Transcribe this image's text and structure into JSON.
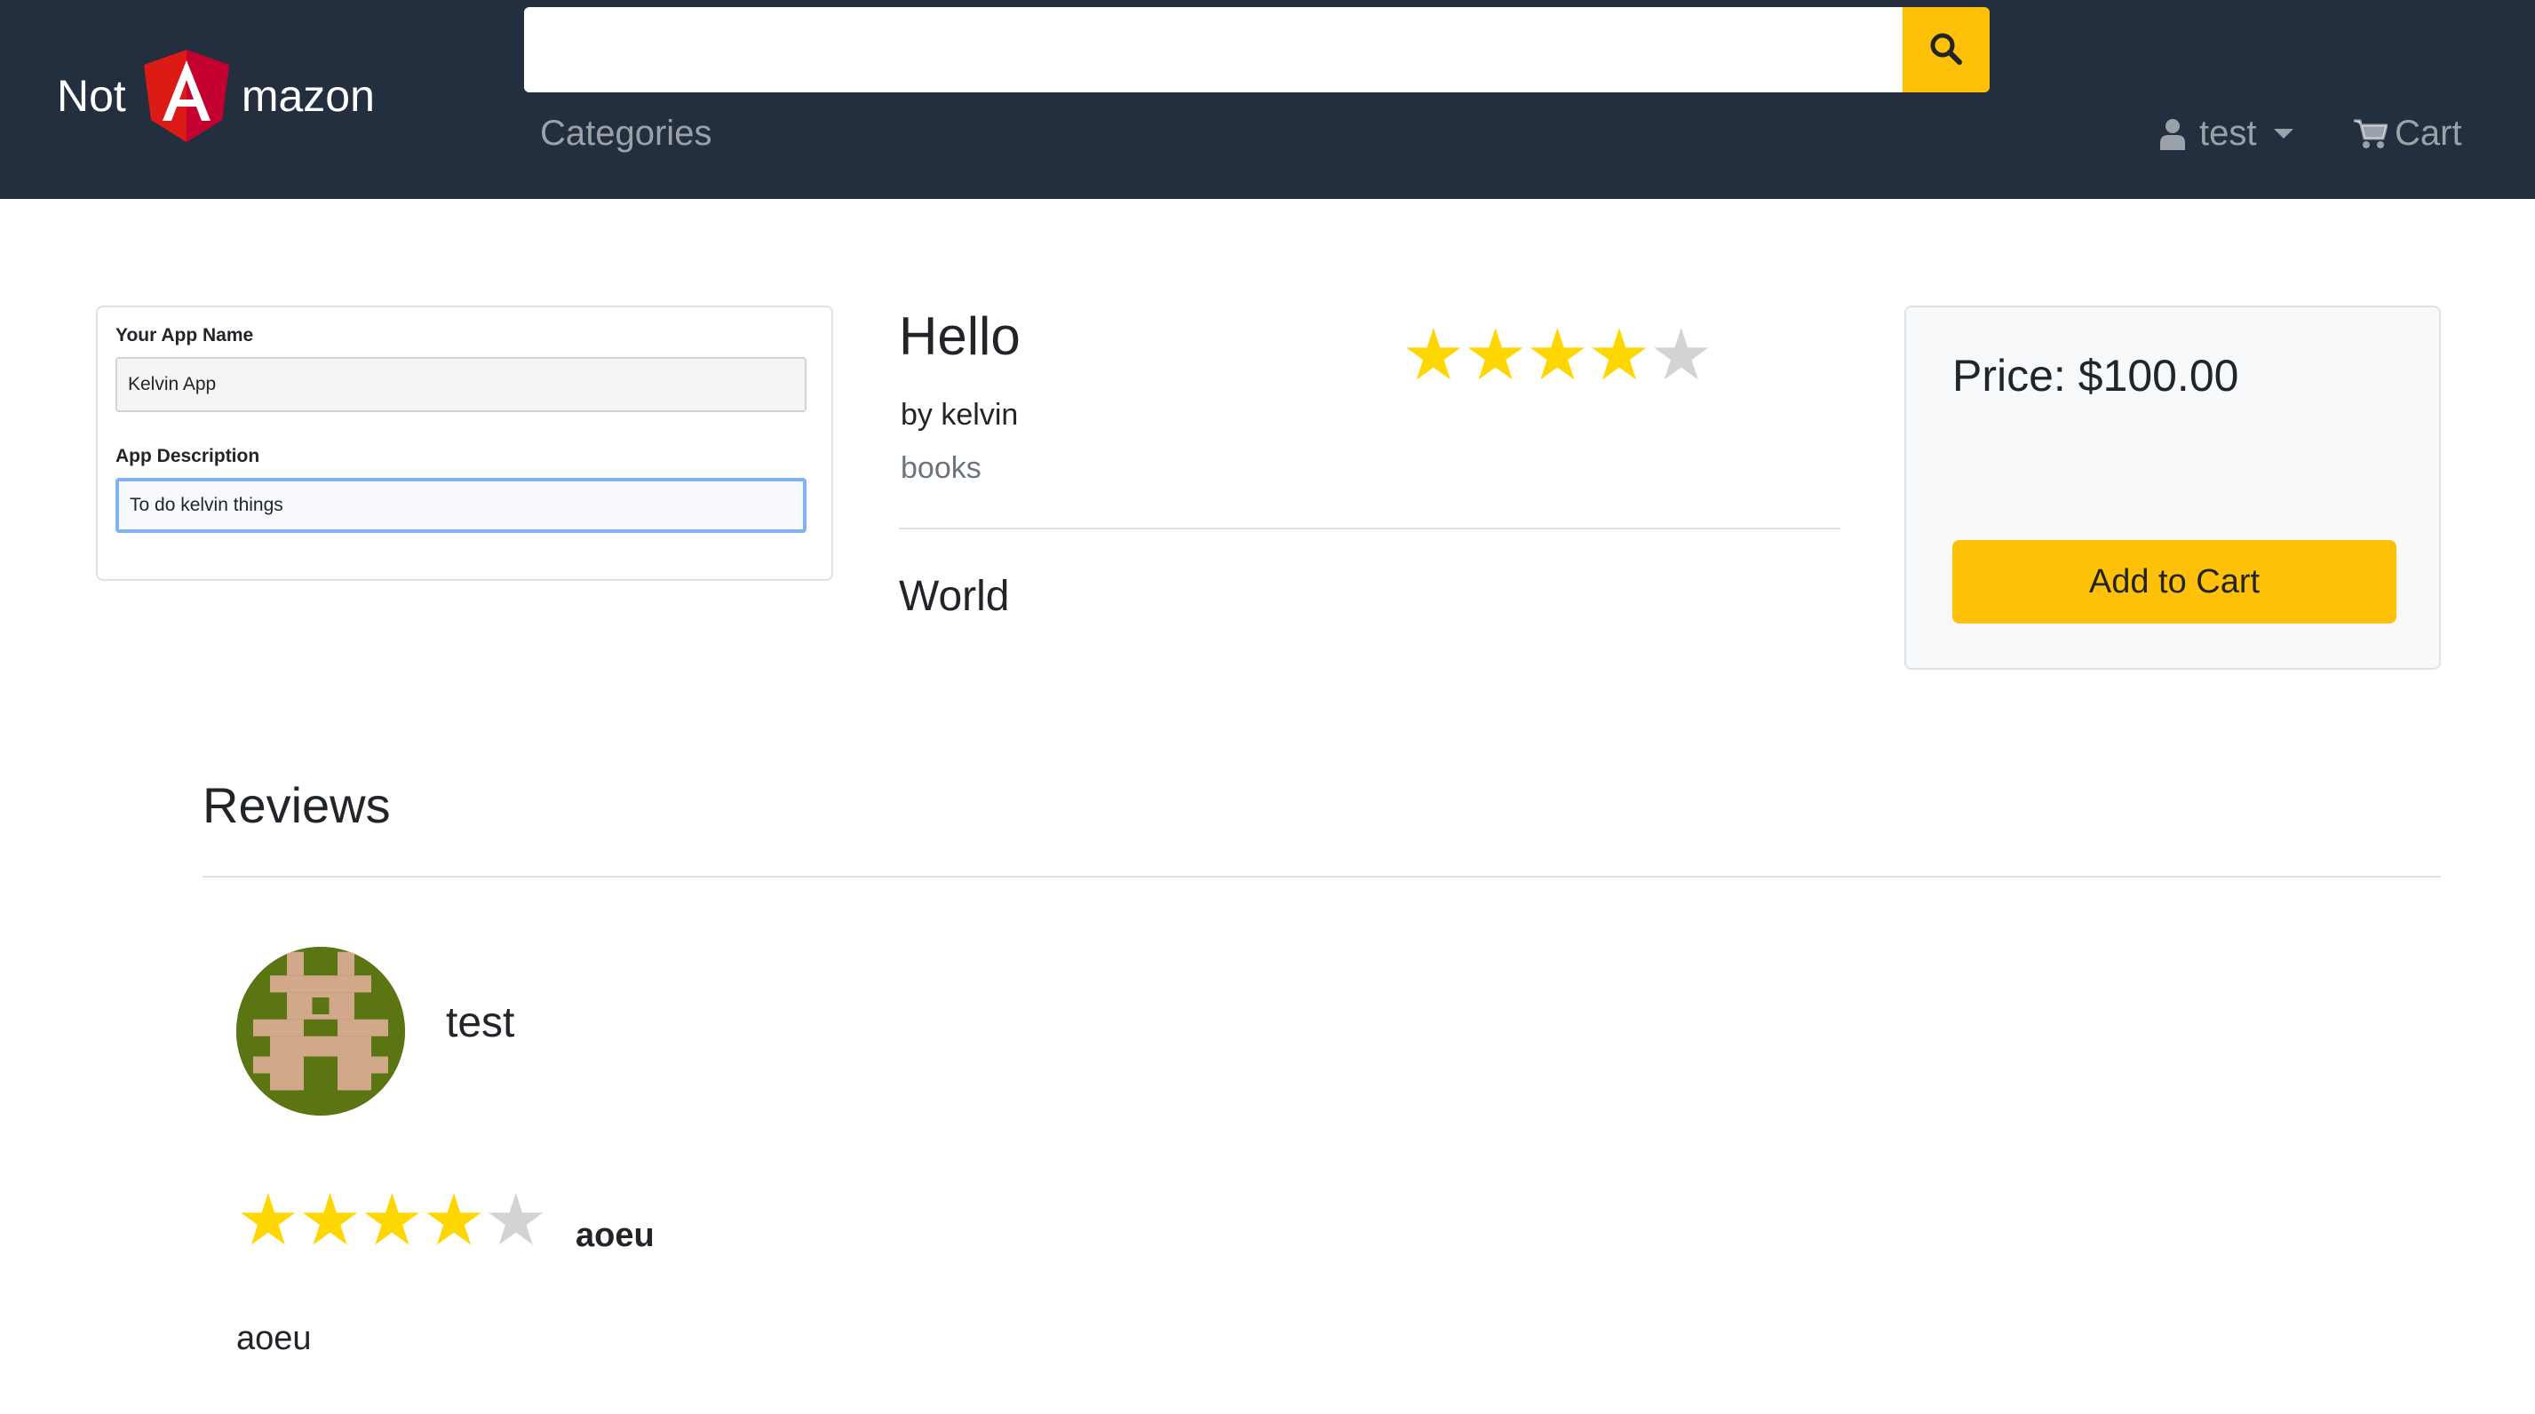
{
  "brand": {
    "prefix": "Not",
    "suffix": "mazon",
    "logo_letter": "A",
    "logo_color": "#dd1b16"
  },
  "search": {
    "value": "",
    "placeholder": "",
    "icon": "search-icon"
  },
  "nav": {
    "categories_label": "Categories",
    "user_label": "test",
    "user_icon": "user-icon",
    "cart_label": "Cart",
    "cart_icon": "shopping-cart-icon",
    "background": "#232f3e"
  },
  "app_form": {
    "name_label": "Your App Name",
    "name_value": "Kelvin App",
    "description_label": "App Description",
    "description_value": "To do kelvin things"
  },
  "product": {
    "title": "Hello",
    "author": "by kelvin",
    "category": "books",
    "rating": 4,
    "max_rating": 5,
    "description": "World"
  },
  "price_card": {
    "price_label": "Price: $100.00",
    "add_to_cart_label": "Add to Cart",
    "accent": "#ffc107"
  },
  "reviews": {
    "heading": "Reviews",
    "items": [
      {
        "reviewer": "test",
        "avatar": "identicon-avatar",
        "rating": 4,
        "max_rating": 5,
        "title": "aoeu",
        "body": "aoeu"
      }
    ]
  },
  "colors": {
    "star_filled": "#ffd700",
    "star_empty": "#d3d3d3"
  }
}
